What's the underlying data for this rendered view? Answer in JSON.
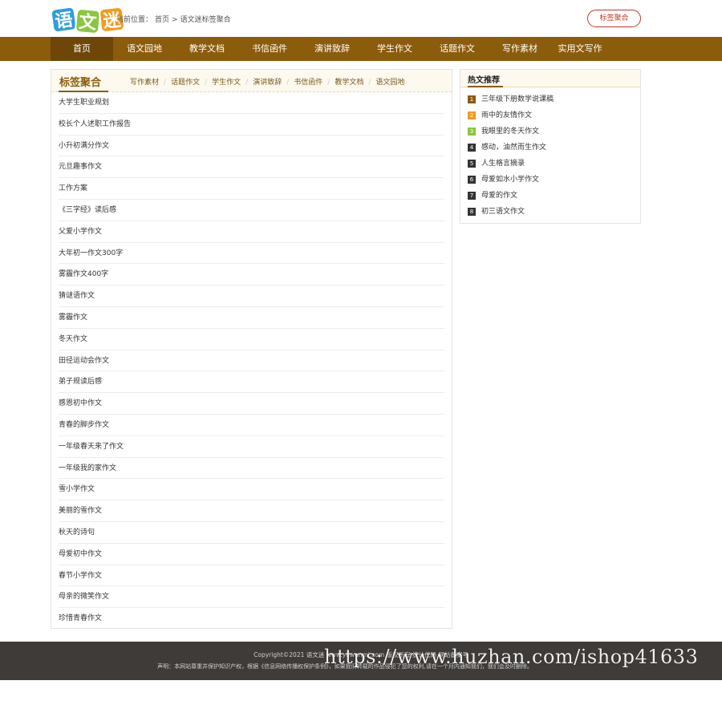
{
  "logo": {
    "chars": [
      "语",
      "文",
      "迷"
    ],
    "colors": [
      "#2f9de0",
      "#8cc63f",
      "#f39a1e"
    ]
  },
  "breadcrumb": {
    "items": [
      "当前位置：",
      "首页",
      ">",
      "语文迷标签聚合"
    ]
  },
  "tag_button": "标签聚合",
  "nav": {
    "items": [
      "首页",
      "语文园地",
      "教学文档",
      "书信函件",
      "演讲致辞",
      "学生作文",
      "话题作文",
      "写作素材",
      "实用文写作"
    ],
    "active_index": 0,
    "bg_color": "#8b5c0c"
  },
  "main": {
    "title": "标签聚合",
    "links": [
      "写作素材",
      "话题作文",
      "学生作文",
      "演讲致辞",
      "书信函件",
      "教学文档",
      "语文园地"
    ],
    "tags": [
      "大学生职业规划",
      "校长个人述职工作报告",
      "小升初满分作文",
      "元旦趣事作文",
      "工作方案",
      "《三字经》读后感",
      "父爱小学作文",
      "大年初一作文300字",
      "雾霾作文400字",
      "猜谜语作文",
      "雾霾作文",
      "冬天作文",
      "田径运动会作文",
      "弟子规读后感",
      "感恩初中作文",
      "青春的脚步作文",
      "一年级春天来了作文",
      "一年级我的家作文",
      "雪小学作文",
      "美丽的雪作文",
      "秋天的诗句",
      "母爱初中作文",
      "春节小学作文",
      "母亲的微笑作文",
      "珍惜青春作文"
    ]
  },
  "side": {
    "title": "热文推荐",
    "items": [
      {
        "num": "1",
        "text": "三年级下册数学说课稿",
        "color": "#8b5c0c"
      },
      {
        "num": "2",
        "text": "雨中的友情作文",
        "color": "#f39a1e"
      },
      {
        "num": "3",
        "text": "我眼里的冬天作文",
        "color": "#8cc63f"
      },
      {
        "num": "4",
        "text": "感动，油然而生作文",
        "color": "#333333"
      },
      {
        "num": "5",
        "text": "人生格言摘录",
        "color": "#333333"
      },
      {
        "num": "6",
        "text": "母爱如水小学作文",
        "color": "#333333"
      },
      {
        "num": "7",
        "text": "母爱的作文",
        "color": "#333333"
      },
      {
        "num": "8",
        "text": "初三语文作文",
        "color": "#333333"
      }
    ]
  },
  "footer": {
    "line1": "Copyright©2021 语文迷 www.yuwenmi.com 版权所有 统计代码 网站备案号",
    "line2": "声明：本网站尊重并保护知识产权，根据《信息网络传播权保护条例》，如果我们转载的作品侵犯了您的权利,请在一个月内通知我们，我们会及时删除。"
  },
  "watermark": "https://www.huzhan.com/ishop41633"
}
